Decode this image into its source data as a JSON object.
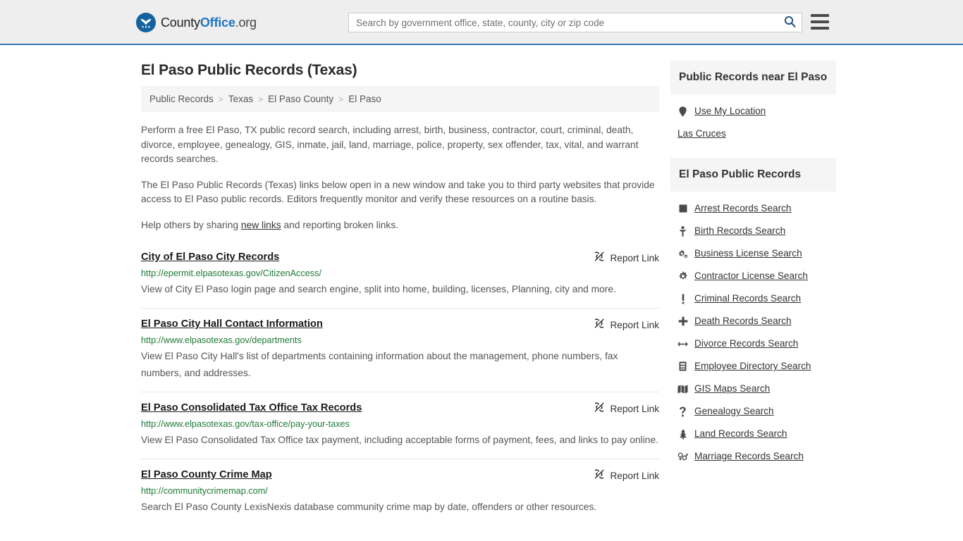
{
  "brand": {
    "part1": "County",
    "part2": "Office",
    "part3": ".org",
    "logo_icon": "eagle-stars-seal-icon"
  },
  "search": {
    "placeholder": "Search by government office, state, county, city or zip code",
    "value": "",
    "search_icon": "search-icon",
    "menu_icon": "hamburger-menu-icon"
  },
  "colors": {
    "header_bg": "#eeeeee",
    "header_border": "#3a77ab",
    "brand_blue": "#2176bd",
    "url_green": "#1f7a36",
    "panel_bg": "#f5f5f5"
  },
  "page": {
    "title": "El Paso Public Records (Texas)"
  },
  "breadcrumb": {
    "separator": ">",
    "items": [
      {
        "label": "Public Records"
      },
      {
        "label": "Texas"
      },
      {
        "label": "El Paso County"
      },
      {
        "label": "El Paso"
      }
    ]
  },
  "intro": {
    "p1": "Perform a free El Paso, TX public record search, including arrest, birth, business, contractor, court, criminal, death, divorce, employee, genealogy, GIS, inmate, jail, land, marriage, police, property, sex offender, tax, vital, and warrant records searches.",
    "p2": "The El Paso Public Records (Texas) links below open in a new window and take you to third party websites that provide access to El Paso public records. Editors frequently monitor and verify these resources on a routine basis.",
    "p3_before": "Help others by sharing ",
    "p3_link": "new links",
    "p3_after": " and reporting broken links."
  },
  "results": {
    "report_label": "Report Link",
    "report_icon": "broken-link-icon",
    "items": [
      {
        "title": "City of El Paso City Records",
        "url": "http://epermit.elpasotexas.gov/CitizenAccess/",
        "description": "View of City El Paso login page and search engine, split into home, building, licenses, Planning, city and more."
      },
      {
        "title": "El Paso City Hall Contact Information",
        "url": "http://www.elpasotexas.gov/departments",
        "description": "View El Paso City Hall's list of departments containing information about the management, phone numbers, fax numbers, and addresses."
      },
      {
        "title": "El Paso Consolidated Tax Office Tax Records",
        "url": "http://www.elpasotexas.gov/tax-office/pay-your-taxes",
        "description": "View El Paso Consolidated Tax Office tax payment, including acceptable forms of payment, fees, and links to pay online."
      },
      {
        "title": "El Paso County Crime Map",
        "url": "http://communitycrimemap.com/",
        "description": "Search El Paso County LexisNexis database community crime map by date, offenders or other resources."
      }
    ]
  },
  "sidebar": {
    "near": {
      "heading": "Public Records near El Paso",
      "items": [
        {
          "label": "Use My Location",
          "icon": "map-pin-icon"
        },
        {
          "label": "Las Cruces",
          "icon": ""
        }
      ]
    },
    "records": {
      "heading": "El Paso Public Records",
      "items": [
        {
          "label": "Arrest Records Search",
          "icon": "fingerprint-square-icon"
        },
        {
          "label": "Birth Records Search",
          "icon": "baby-icon"
        },
        {
          "label": "Business License Search",
          "icon": "cogs-icon"
        },
        {
          "label": "Contractor License Search",
          "icon": "gear-icon"
        },
        {
          "label": "Criminal Records Search",
          "icon": "exclamation-icon"
        },
        {
          "label": "Death Records Search",
          "icon": "cross-plus-icon"
        },
        {
          "label": "Divorce Records Search",
          "icon": "arrows-left-right-icon"
        },
        {
          "label": "Employee Directory Search",
          "icon": "id-card-icon"
        },
        {
          "label": "GIS Maps Search",
          "icon": "map-icon"
        },
        {
          "label": "Genealogy Search",
          "icon": "question-mark-icon"
        },
        {
          "label": "Land Records Search",
          "icon": "tree-icon"
        },
        {
          "label": "Marriage Records Search",
          "icon": "gender-symbols-icon"
        }
      ]
    }
  }
}
